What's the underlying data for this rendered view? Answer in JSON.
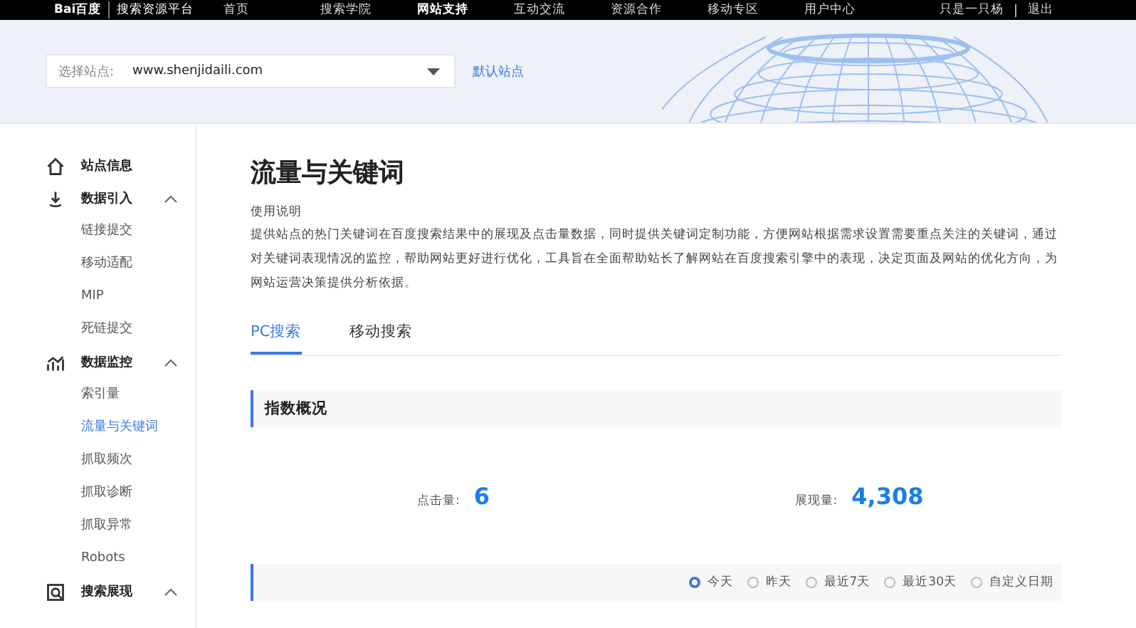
{
  "top_nav": {
    "logo": "Bai百度",
    "platform": "搜索资源平台",
    "items": [
      {
        "label": "首页",
        "selected": false
      },
      {
        "label": "搜索学院",
        "selected": false
      },
      {
        "label": "网站支持",
        "selected": true
      },
      {
        "label": "互动交流",
        "selected": false
      },
      {
        "label": "资源合作",
        "selected": false
      },
      {
        "label": "移动专区",
        "selected": false
      },
      {
        "label": "用户中心",
        "selected": false
      }
    ],
    "user": "只是一只杨",
    "logout": "退出"
  },
  "site_select": {
    "label": "选择站点:",
    "value": "www.shenjidaili.com",
    "default_link": "默认站点"
  },
  "sidebar": [
    {
      "label": "站点信息",
      "kind": "home"
    },
    {
      "label": "数据引入",
      "kind": "import",
      "expanded": true,
      "children": [
        {
          "label": "链接提交",
          "selected": false
        },
        {
          "label": "移动适配",
          "selected": false
        },
        {
          "label": "MIP",
          "selected": false
        },
        {
          "label": "死链提交",
          "selected": false
        }
      ]
    },
    {
      "label": "数据监控",
      "kind": "chart",
      "expanded": true,
      "children": [
        {
          "label": "索引量",
          "selected": false
        },
        {
          "label": "流量与关键词",
          "selected": true
        },
        {
          "label": "抓取频次",
          "selected": false
        },
        {
          "label": "抓取诊断",
          "selected": false
        },
        {
          "label": "抓取异常",
          "selected": false
        },
        {
          "label": "Robots",
          "selected": false
        }
      ]
    },
    {
      "label": "搜索展现",
      "kind": "search",
      "expanded": true
    }
  ],
  "page": {
    "title": "流量与关键词",
    "help_heading": "使用说明",
    "help_text": "提供站点的热门关键词在百度搜索结果中的展现及点击量数据，同时提供关键词定制功能，方便网站根据需求设置需要重点关注的关键词，通过对关键词表现情况的监控，帮助网站更好进行优化，工具旨在全面帮助站长了解网站在百度搜索引擎中的表现，决定页面及网站的优化方向，为网站运营决策提供分析依据。"
  },
  "tabs": [
    {
      "label": "PC搜索",
      "selected": true
    },
    {
      "label": "移动搜索",
      "selected": false
    }
  ],
  "overview": {
    "title": "指数概况",
    "stats": [
      {
        "label": "点击量:",
        "value": "6"
      },
      {
        "label": "展现量:",
        "value": "4,308"
      }
    ]
  },
  "trend": {
    "ranges": [
      {
        "label": "今天",
        "selected": true
      },
      {
        "label": "昨天",
        "selected": false
      },
      {
        "label": "最近7天",
        "selected": false
      },
      {
        "label": "最近30天",
        "selected": false
      },
      {
        "label": "自定义日期",
        "selected": false
      }
    ]
  }
}
